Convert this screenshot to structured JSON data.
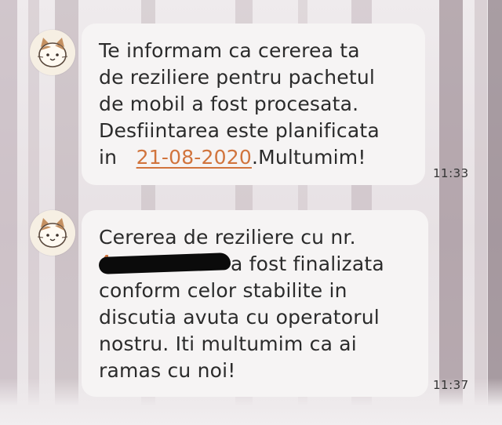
{
  "messages": [
    {
      "avatar": "cat-avatar",
      "time": "11:33",
      "lines": [
        "Te informam ca cererea ta",
        "de reziliere pentru pachetul",
        "de mobil a fost procesata.",
        "Desfiintarea este planificata"
      ],
      "last_prefix": "in",
      "date_link": "21-08-2020",
      "last_suffix": ".Multumim!"
    },
    {
      "avatar": "cat-avatar",
      "time": "11:37",
      "line1": "Cererea de reziliere cu nr.",
      "redacted_peek": "4",
      "line2_suffix": "a fost finalizata",
      "lines": [
        "conform celor stabilite in",
        "discutia avuta cu operatorul",
        "nostru. Iti multumim ca ai",
        "ramas cu noi!"
      ]
    }
  ],
  "colors": {
    "link": "#d1743d",
    "bubble": "#f6f4f4",
    "text": "#2b2b2b"
  }
}
